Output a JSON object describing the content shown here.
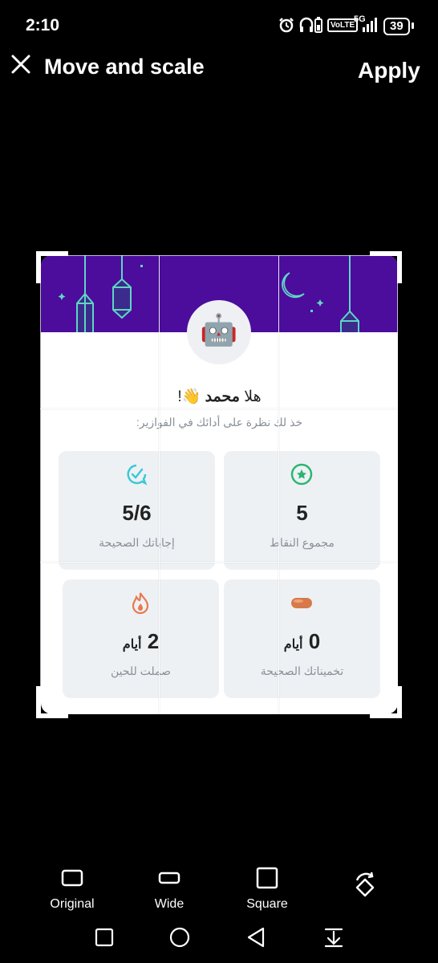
{
  "status_bar": {
    "time": "2:10",
    "network": "5G",
    "volte": "VoLTE",
    "battery": "39"
  },
  "header": {
    "title": "Move and scale",
    "apply_label": "Apply"
  },
  "image_content": {
    "greeting_prefix": "هلا",
    "greeting_name": "محمد",
    "greeting_suffix": "👋!",
    "subtitle": "خذ لك نظرة على أدائك في الفوازير:",
    "avatar_emoji": "🤖",
    "stats": [
      {
        "value": "5",
        "unit": "",
        "label": "مجموع النقاط",
        "icon": "star-badge-icon",
        "color": "#2bb673"
      },
      {
        "value": "5/6",
        "unit": "",
        "label": "إجاباتك الصحيحة",
        "icon": "chat-check-icon",
        "color": "#3cc8d8"
      },
      {
        "value": "0",
        "unit": "أيام",
        "label": "تخميناتك الصحيحة",
        "icon": "date-icon",
        "color": "#d77a4a"
      },
      {
        "value": "2",
        "unit": "أيام",
        "label": "صملت للحين",
        "icon": "flame-icon",
        "color": "#e8794f"
      }
    ]
  },
  "options": [
    {
      "label": "Original",
      "icon": "original-ratio-icon"
    },
    {
      "label": "Wide",
      "icon": "wide-ratio-icon"
    },
    {
      "label": "Square",
      "icon": "square-ratio-icon"
    },
    {
      "label": "",
      "icon": "rotate-icon"
    }
  ],
  "nav": [
    "recents-icon",
    "home-icon",
    "back-icon",
    "notification-shade-icon"
  ]
}
